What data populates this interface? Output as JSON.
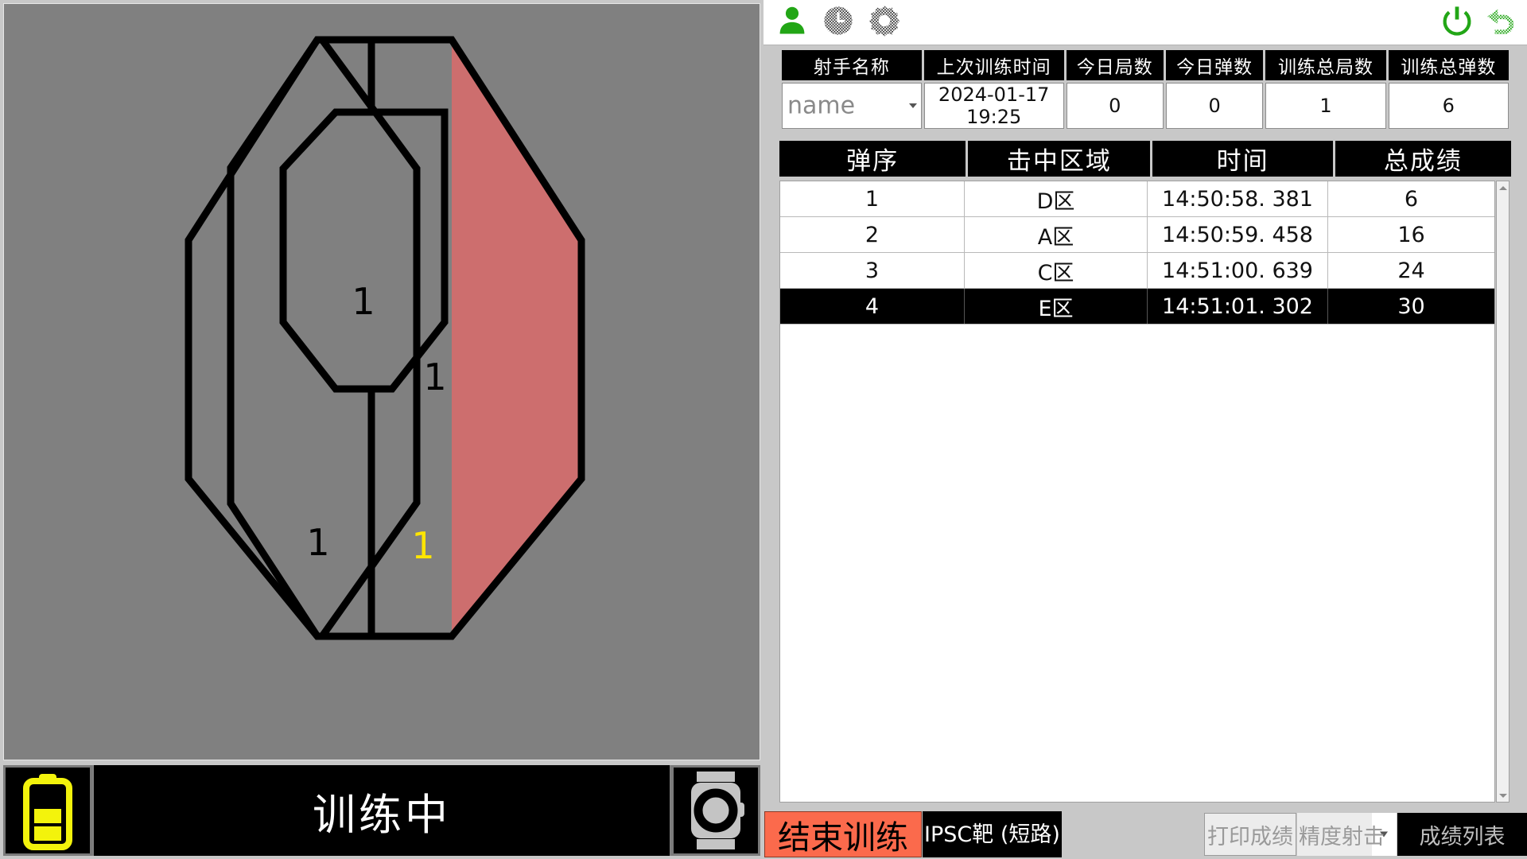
{
  "toolbar": {
    "icons_left": [
      {
        "name": "person-icon",
        "label": "用户",
        "state": "active"
      },
      {
        "name": "clock-icon",
        "label": "历史",
        "state": "disabled"
      },
      {
        "name": "gear-icon",
        "label": "设置",
        "state": "disabled"
      }
    ],
    "icons_right": [
      {
        "name": "power-icon",
        "label": "电源",
        "state": "active"
      },
      {
        "name": "undo-icon",
        "label": "返回",
        "state": "disabled"
      }
    ],
    "accent_green": "#22a616"
  },
  "info": {
    "headers": [
      "射手名称",
      "上次训练时间",
      "今日局数",
      "今日弹数",
      "训练总局数",
      "训练总弹数"
    ],
    "values": {
      "shooter_name": "name",
      "last_training_time": "2024-01-17  19:25",
      "today_rounds": "0",
      "today_shots": "0",
      "total_rounds": "1",
      "total_shots": "6"
    }
  },
  "results": {
    "headers": [
      "弹序",
      "击中区域",
      "时间",
      "总成绩"
    ],
    "rows": [
      {
        "index": "1",
        "zone": "D区",
        "time": "14:50:58. 381",
        "score": "6",
        "selected": false
      },
      {
        "index": "2",
        "zone": "A区",
        "time": "14:50:59. 458",
        "score": "16",
        "selected": false
      },
      {
        "index": "3",
        "zone": "C区",
        "time": "14:51:00. 639",
        "score": "24",
        "selected": false
      },
      {
        "index": "4",
        "zone": "E区",
        "time": "14:51:01. 302",
        "score": "30",
        "selected": true
      }
    ]
  },
  "status": {
    "text": "训练中",
    "battery": {
      "name": "battery-icon",
      "segments_filled": 2,
      "segments_total": 3,
      "color": "#f3f30c"
    },
    "camera": {
      "name": "camera-icon"
    }
  },
  "bottom": {
    "end_training": "结束训练",
    "target_mode": "IPSC靶 (短路)",
    "print_score": "打印成绩",
    "precision_shooting": "精度射击",
    "score_list": "成绩列表"
  },
  "target": {
    "type": "IPSC",
    "background": "#808080",
    "hit_zone_color": "#cd6e6e",
    "hit_zone_side": "right",
    "hit_counts": [
      {
        "zone": "A",
        "count": "1",
        "color": "#000000"
      },
      {
        "zone": "C",
        "count": "1",
        "color": "#000000"
      },
      {
        "zone": "D",
        "count": "1",
        "color": "#000000"
      },
      {
        "zone": "E",
        "count": "1",
        "color": "#ffe500"
      }
    ]
  }
}
